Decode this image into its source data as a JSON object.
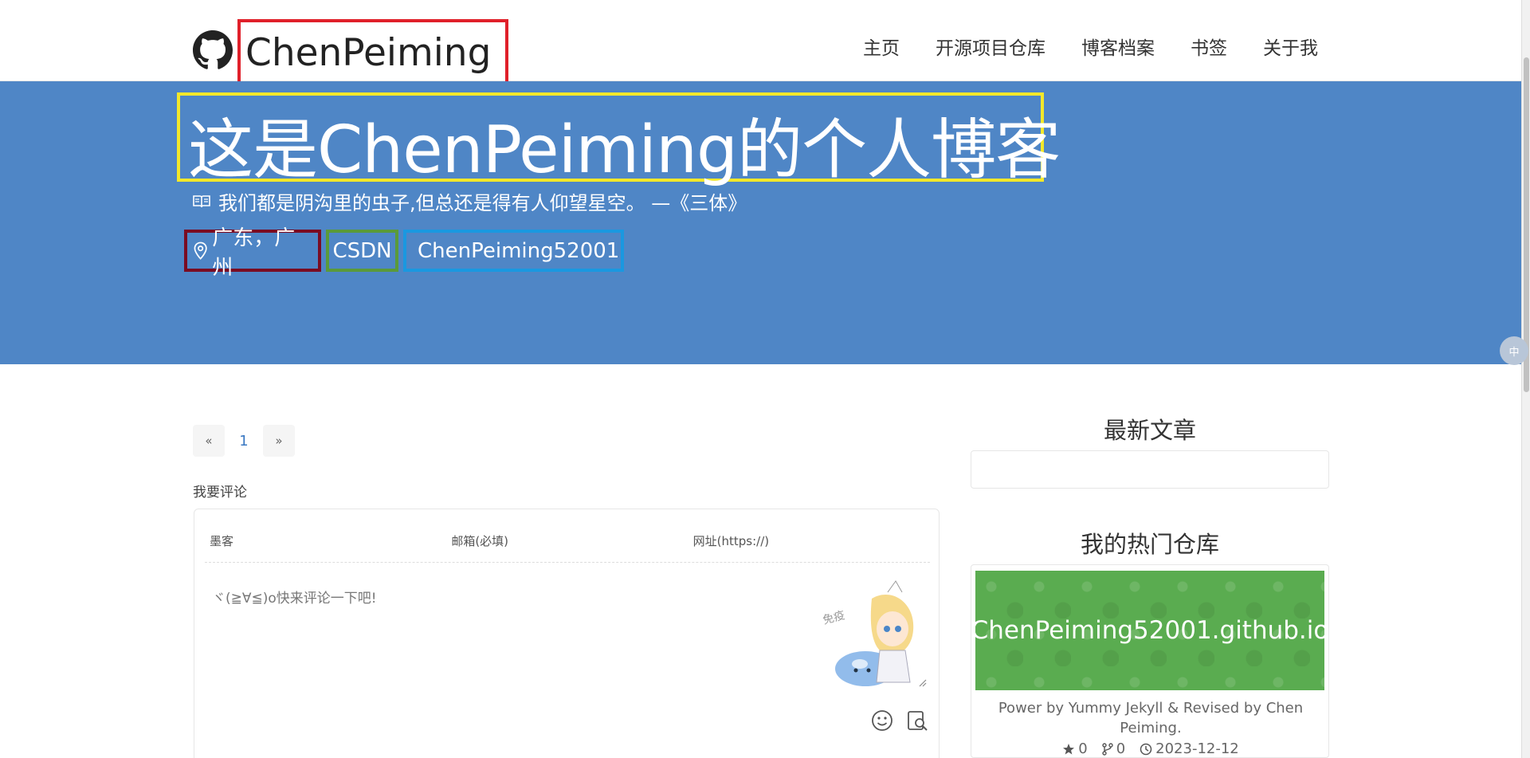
{
  "navbar": {
    "brand": "ChenPeiming",
    "links": [
      "主页",
      "开源项目仓库",
      "博客档案",
      "书签",
      "关于我"
    ]
  },
  "banner": {
    "title": "这是ChenPeiming的个人博客",
    "quote": "我们都是阴沟里的虫子,但总还是得有人仰望星空。 —《三体》",
    "location": "广东，广州",
    "csdn": "CSDN",
    "github": "ChenPeiming52001",
    "bg_color": "#4f86c6"
  },
  "pagination": {
    "prev": "«",
    "current": "1",
    "next": "»"
  },
  "comments": {
    "title": "我要评论",
    "nick_placeholder": "墨客",
    "email_placeholder": "邮箱(必填)",
    "url_placeholder": "网址(https://)",
    "text_placeholder": "ヾ(≧∀≦)o快来评论一下吧!"
  },
  "sidebar": {
    "latest_title": "最新文章",
    "repos_title": "我的热门仓库",
    "repo": {
      "name": "ChenPeiming52001.github.io",
      "description": "Power by Yummy Jekyll & Revised by Chen Peiming.",
      "stars": "0",
      "forks": "0",
      "updated": "2023-12-12",
      "color": "#5aac50"
    }
  },
  "widget": {
    "label": "中"
  }
}
